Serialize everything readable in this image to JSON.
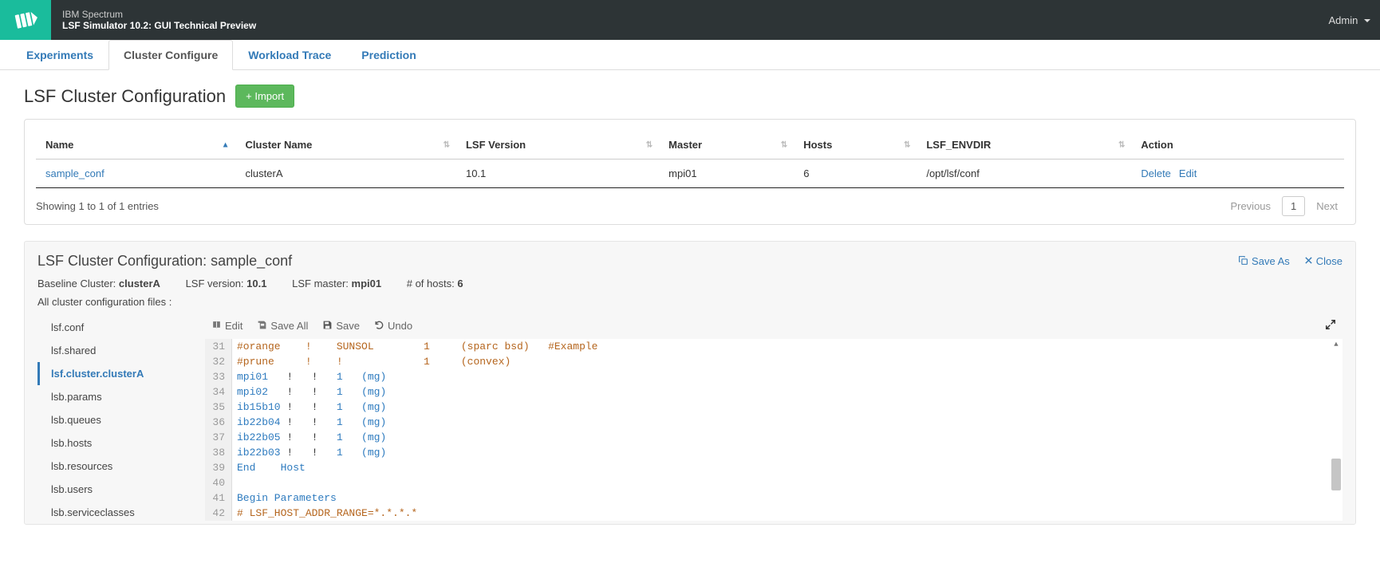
{
  "brand": {
    "top": "IBM Spectrum",
    "bottom": "LSF Simulator 10.2: GUI Technical Preview"
  },
  "user_menu": "Admin",
  "tabs": [
    "Experiments",
    "Cluster Configure",
    "Workload Trace",
    "Prediction"
  ],
  "active_tab": 1,
  "page_title": "LSF Cluster Configuration",
  "import_label": "+ Import",
  "table": {
    "headers": [
      "Name",
      "Cluster Name",
      "LSF Version",
      "Master",
      "Hosts",
      "LSF_ENVDIR",
      "Action"
    ],
    "rows": [
      {
        "name": "sample_conf",
        "cluster": "clusterA",
        "version": "10.1",
        "master": "mpi01",
        "hosts": "6",
        "envdir": "/opt/lsf/conf",
        "actions": [
          "Delete",
          "Edit"
        ]
      }
    ],
    "footer_info": "Showing 1 to 1 of 1 entries",
    "prev": "Previous",
    "page": "1",
    "next": "Next"
  },
  "detail": {
    "title": "LSF Cluster Configuration: sample_conf",
    "actions": {
      "saveas": "Save As",
      "close": "Close"
    },
    "meta": {
      "baseline_label": "Baseline Cluster:",
      "baseline_value": "clusterA",
      "ver_label": "LSF version:",
      "ver_value": "10.1",
      "master_label": "LSF master:",
      "master_value": "mpi01",
      "hosts_label": "# of hosts:",
      "hosts_value": "6"
    },
    "sub": "All cluster configuration files :",
    "files": [
      "lsf.conf",
      "lsf.shared",
      "lsf.cluster.clusterA",
      "lsb.params",
      "lsb.queues",
      "lsb.hosts",
      "lsb.resources",
      "lsb.users",
      "lsb.serviceclasses"
    ],
    "active_file": 2,
    "toolbar": {
      "edit": "Edit",
      "saveall": "Save All",
      "save": "Save",
      "undo": "Undo"
    },
    "code_lines": [
      {
        "n": 31,
        "segs": [
          [
            "#orange    !    SUNSOL        1     (sparc bsd)   #Example",
            "comment"
          ]
        ]
      },
      {
        "n": 32,
        "segs": [
          [
            "#prune     !    !             1     (convex)",
            "comment"
          ]
        ]
      },
      {
        "n": 33,
        "segs": [
          [
            "mpi01",
            "key"
          ],
          [
            "   !   !   ",
            "punct"
          ],
          [
            "1",
            "num"
          ],
          [
            "   ",
            "punct"
          ],
          [
            "(mg)",
            "paren"
          ]
        ]
      },
      {
        "n": 34,
        "segs": [
          [
            "mpi02",
            "key"
          ],
          [
            "   !   !   ",
            "punct"
          ],
          [
            "1",
            "num"
          ],
          [
            "   ",
            "punct"
          ],
          [
            "(mg)",
            "paren"
          ]
        ]
      },
      {
        "n": 35,
        "segs": [
          [
            "ib15b10",
            "key"
          ],
          [
            " !   !   ",
            "punct"
          ],
          [
            "1",
            "num"
          ],
          [
            "   ",
            "punct"
          ],
          [
            "(mg)",
            "paren"
          ]
        ]
      },
      {
        "n": 36,
        "segs": [
          [
            "ib22b04",
            "key"
          ],
          [
            " !   !   ",
            "punct"
          ],
          [
            "1",
            "num"
          ],
          [
            "   ",
            "punct"
          ],
          [
            "(mg)",
            "paren"
          ]
        ]
      },
      {
        "n": 37,
        "segs": [
          [
            "ib22b05",
            "key"
          ],
          [
            " !   !   ",
            "punct"
          ],
          [
            "1",
            "num"
          ],
          [
            "   ",
            "punct"
          ],
          [
            "(mg)",
            "paren"
          ]
        ]
      },
      {
        "n": 38,
        "segs": [
          [
            "ib22b03",
            "key"
          ],
          [
            " !   !   ",
            "punct"
          ],
          [
            "1",
            "num"
          ],
          [
            "   ",
            "punct"
          ],
          [
            "(mg)",
            "paren"
          ]
        ]
      },
      {
        "n": 39,
        "segs": [
          [
            "End",
            "key"
          ],
          [
            "    ",
            "punct"
          ],
          [
            "Host",
            "key"
          ]
        ]
      },
      {
        "n": 40,
        "segs": [
          [
            "",
            ""
          ]
        ]
      },
      {
        "n": 41,
        "segs": [
          [
            "Begin Parameters",
            "key"
          ]
        ]
      },
      {
        "n": 42,
        "segs": [
          [
            "# LSF_HOST_ADDR_RANGE=*.*.*.*",
            "comment"
          ]
        ]
      }
    ]
  }
}
